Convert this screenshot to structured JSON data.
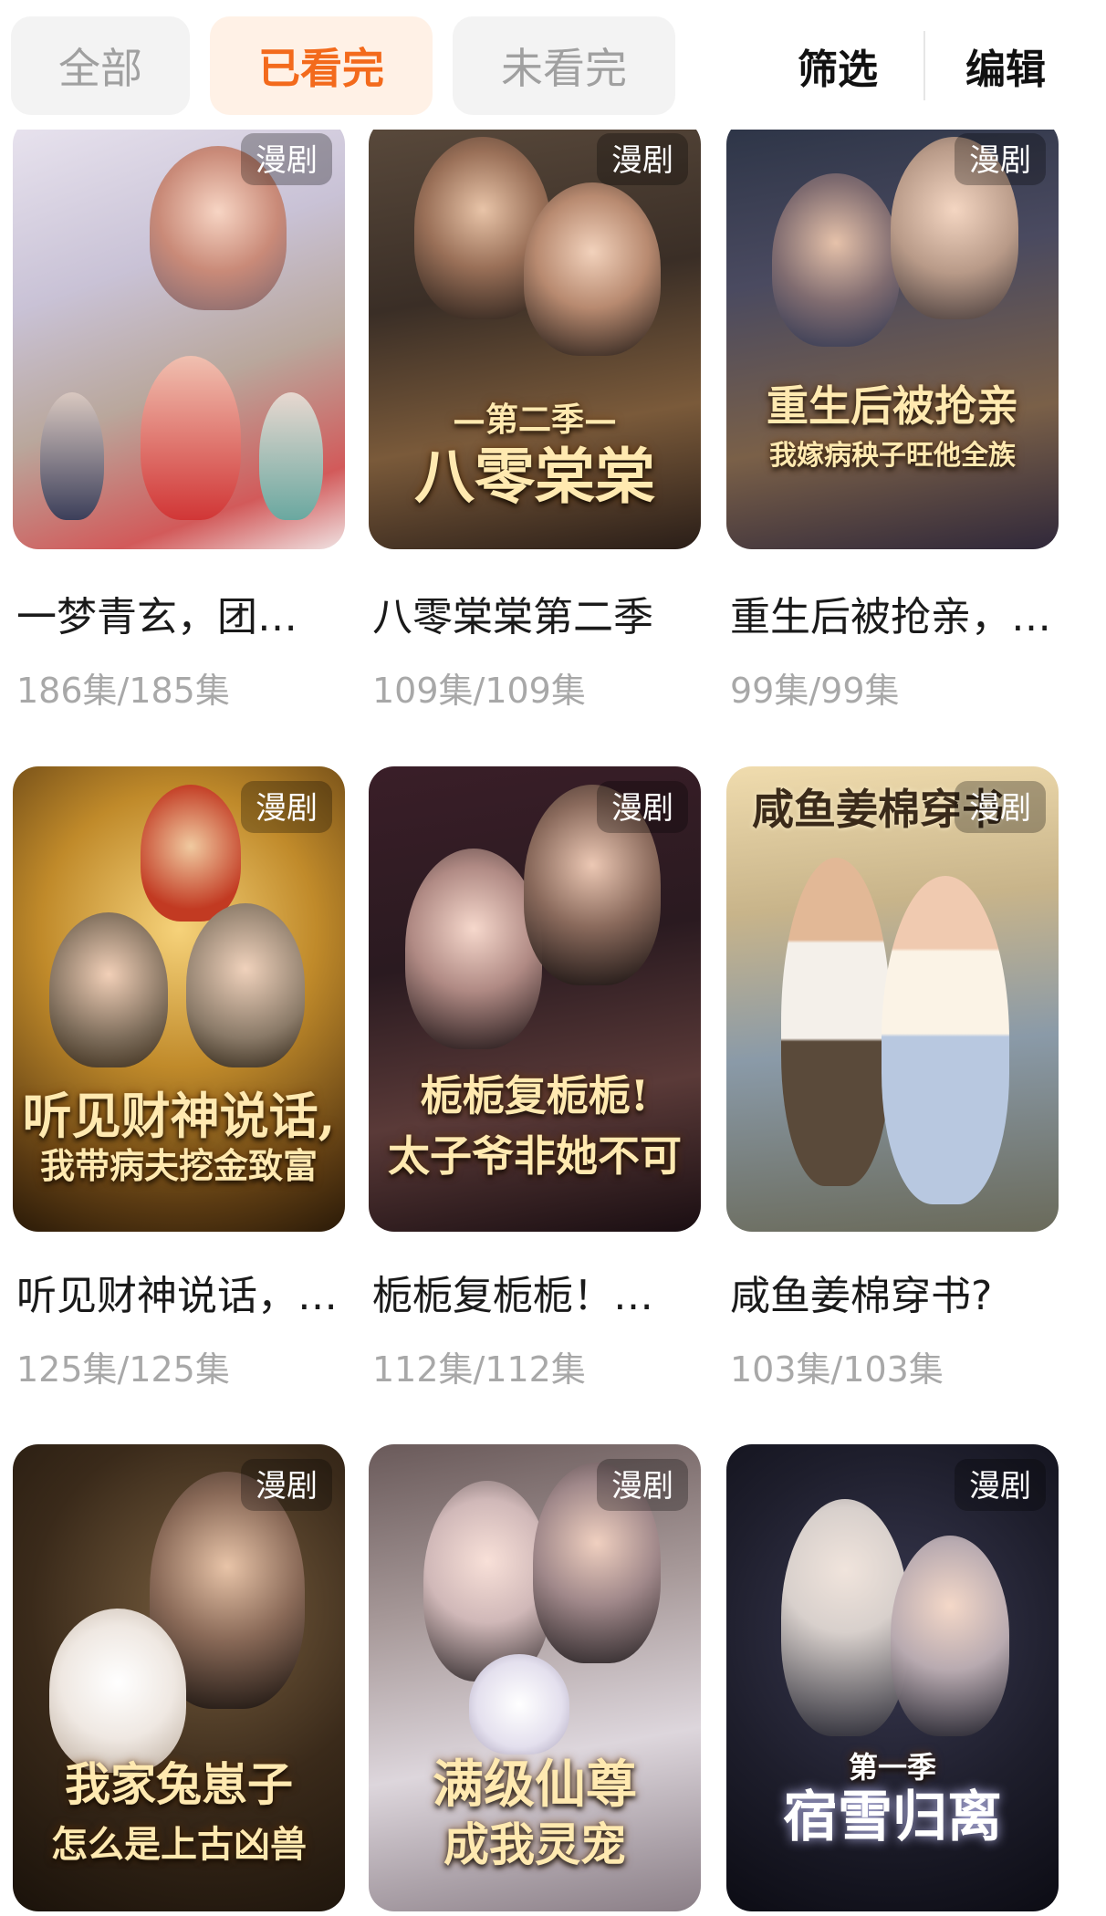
{
  "tabs": [
    {
      "label": "全部",
      "active": false
    },
    {
      "label": "已看完",
      "active": true
    },
    {
      "label": "未看完",
      "active": false
    }
  ],
  "actions": {
    "filter": "筛选",
    "edit": "编辑"
  },
  "accent_color": "#f36a1c",
  "items": [
    {
      "title": "一梦青玄，团…",
      "episodes": "186集/185集",
      "badge": "漫剧",
      "cover_text": "",
      "cover_sub": ""
    },
    {
      "title": "八零棠棠第二季",
      "episodes": "109集/109集",
      "badge": "漫剧",
      "cover_text": "八零棠棠",
      "cover_sub": "—第二季—"
    },
    {
      "title": "重生后被抢亲，…",
      "episodes": "99集/99集",
      "badge": "漫剧",
      "cover_text": "重生后被抢亲",
      "cover_sub": "我嫁病秧子旺他全族"
    },
    {
      "title": "听见财神说话，…",
      "episodes": "125集/125集",
      "badge": "漫剧",
      "cover_text": "听见财神说话,",
      "cover_sub": "我带病夫挖金致富"
    },
    {
      "title": "栀栀复栀栀！…",
      "episodes": "112集/112集",
      "badge": "漫剧",
      "cover_text": "栀栀复栀栀!",
      "cover_sub": "太子爷非她不可"
    },
    {
      "title": "咸鱼姜棉穿书?",
      "episodes": "103集/103集",
      "badge": "漫剧",
      "cover_text": "咸鱼姜棉穿书",
      "cover_sub": ""
    },
    {
      "title": "",
      "episodes": "",
      "badge": "漫剧",
      "cover_text": "我家兔崽子",
      "cover_sub": "怎么是上古凶兽"
    },
    {
      "title": "",
      "episodes": "",
      "badge": "漫剧",
      "cover_text": "满级仙尊",
      "cover_sub": "成我灵宠"
    },
    {
      "title": "",
      "episodes": "",
      "badge": "漫剧",
      "cover_text": "宿雪归离",
      "cover_sub": "第一季"
    }
  ]
}
